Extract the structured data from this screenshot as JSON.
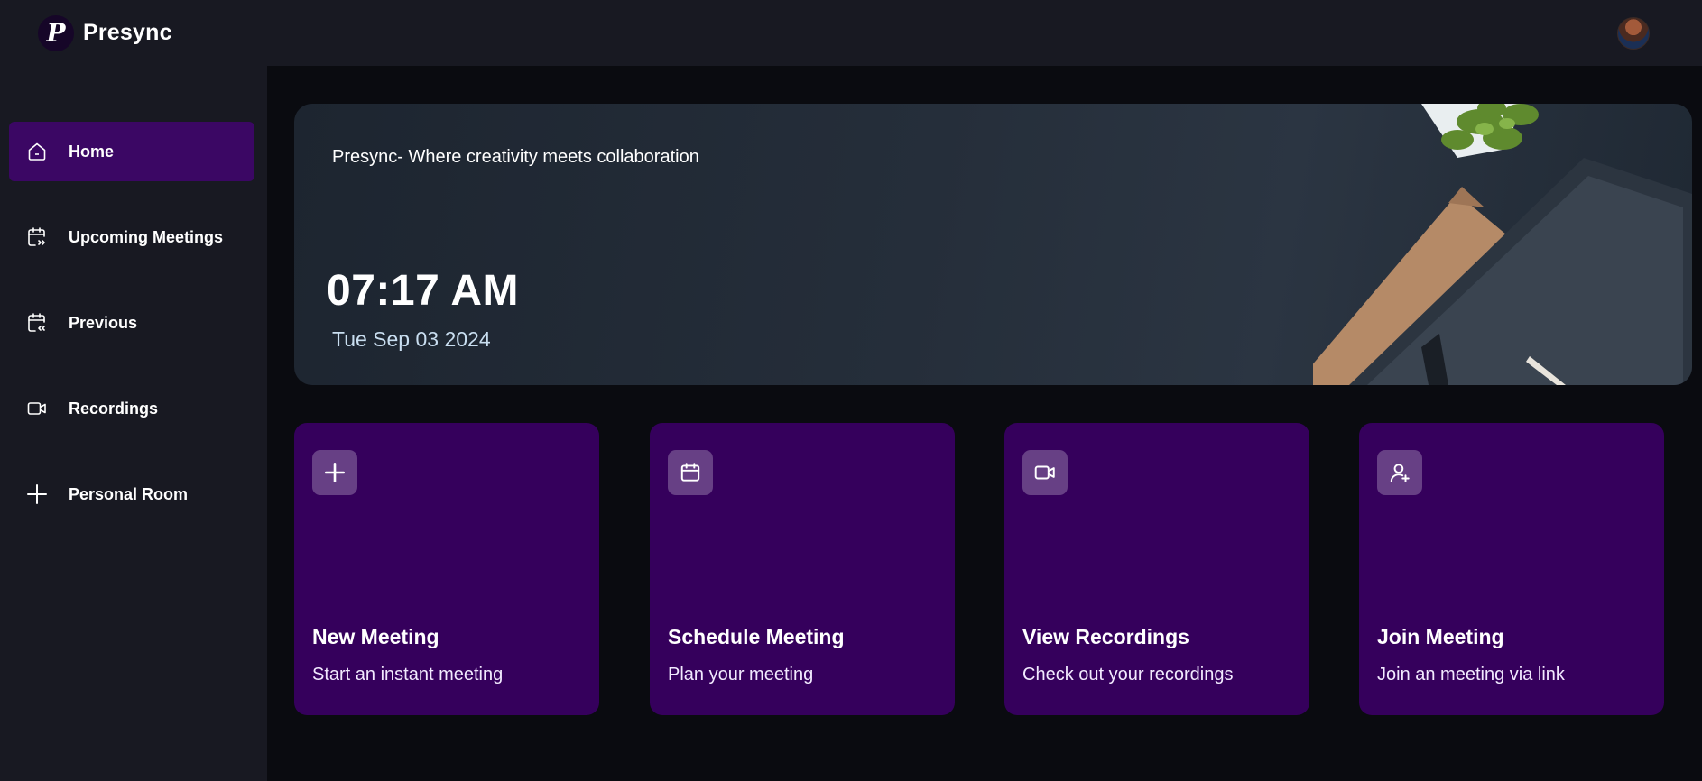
{
  "app": {
    "name": "Presync",
    "logo_letter": "P"
  },
  "sidebar": {
    "items": [
      {
        "label": "Home",
        "icon": "home-icon",
        "active": true
      },
      {
        "label": "Upcoming Meetings",
        "icon": "calendar-upcoming-icon",
        "active": false
      },
      {
        "label": "Previous",
        "icon": "calendar-previous-icon",
        "active": false
      },
      {
        "label": "Recordings",
        "icon": "video-icon",
        "active": false
      },
      {
        "label": "Personal Room",
        "icon": "plus-icon",
        "active": false
      }
    ]
  },
  "hero": {
    "tagline": "Presync- Where creativity meets collaboration",
    "time": "07:17 AM",
    "date": "Tue Sep 03 2024"
  },
  "cards": [
    {
      "title": "New Meeting",
      "subtitle": "Start an instant meeting",
      "icon": "plus-icon"
    },
    {
      "title": "Schedule Meeting",
      "subtitle": "Plan your meeting",
      "icon": "calendar-icon"
    },
    {
      "title": "View Recordings",
      "subtitle": "Check out your recordings",
      "icon": "video-icon"
    },
    {
      "title": "Join Meeting",
      "subtitle": "Join an meeting via link",
      "icon": "user-plus-icon"
    }
  ],
  "colors": {
    "navbar_bg": "#181922",
    "page_bg": "#0a0b10",
    "active_item": "#3b0764",
    "card_bg": "#35005c"
  }
}
